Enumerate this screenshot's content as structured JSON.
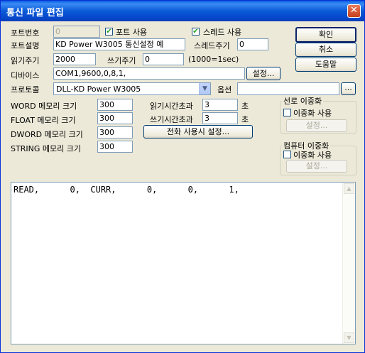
{
  "window": {
    "title": "통신 파일 편집",
    "close": "✕"
  },
  "port": {
    "number_label": "포트번호",
    "number_value": "0",
    "use_label": "포트 사용",
    "use_checked": true
  },
  "thread": {
    "use_label": "스레드 사용",
    "use_checked": true,
    "cycle_label": "스레드주기",
    "cycle_value": "0"
  },
  "description": {
    "label": "포트설명",
    "value": "KD Power W3005 통신설정 예"
  },
  "read_cycle": {
    "label": "읽기주기",
    "value": "2000"
  },
  "write_cycle": {
    "label": "쓰기주기",
    "value": "0",
    "note": "(1000=1sec)"
  },
  "device": {
    "label": "디바이스",
    "value": "COM1,9600,0,8,1,",
    "settings_button": "설정..."
  },
  "protocol": {
    "label": "프로토콜",
    "value": "DLL-KD Power W3005",
    "arrow": "▼"
  },
  "option": {
    "label": "옵션",
    "value": "",
    "browse_button": "..."
  },
  "memory": {
    "word": {
      "label": "WORD 메모리 크기",
      "value": "300"
    },
    "float": {
      "label": "FLOAT 메모리 크기",
      "value": "300"
    },
    "dword": {
      "label": "DWORD 메모리 크기",
      "value": "300"
    },
    "string": {
      "label": "STRING 메모리 크기",
      "value": "300"
    }
  },
  "timeouts": {
    "read": {
      "label": "읽기시간초과",
      "value": "3",
      "unit": "초"
    },
    "write": {
      "label": "쓰기시간초과",
      "value": "3",
      "unit": "초"
    }
  },
  "phone_settings_button": "전화 사용시 설정...",
  "buttons": {
    "ok": "확인",
    "cancel": "취소",
    "help": "도움말"
  },
  "line_redundancy": {
    "title": "선로 이중화",
    "check_label": "이중화 사용",
    "checked": false,
    "settings": "설정..."
  },
  "computer_redundancy": {
    "title": "컴퓨터 이중화",
    "check_label": "이중화 사용",
    "checked": false,
    "settings": "설정..."
  },
  "script": {
    "content": "READ,      0,  CURR,      0,      0,      1,"
  },
  "scroll": {
    "up": "▲",
    "down": "▼"
  },
  "check_mark": "✔"
}
